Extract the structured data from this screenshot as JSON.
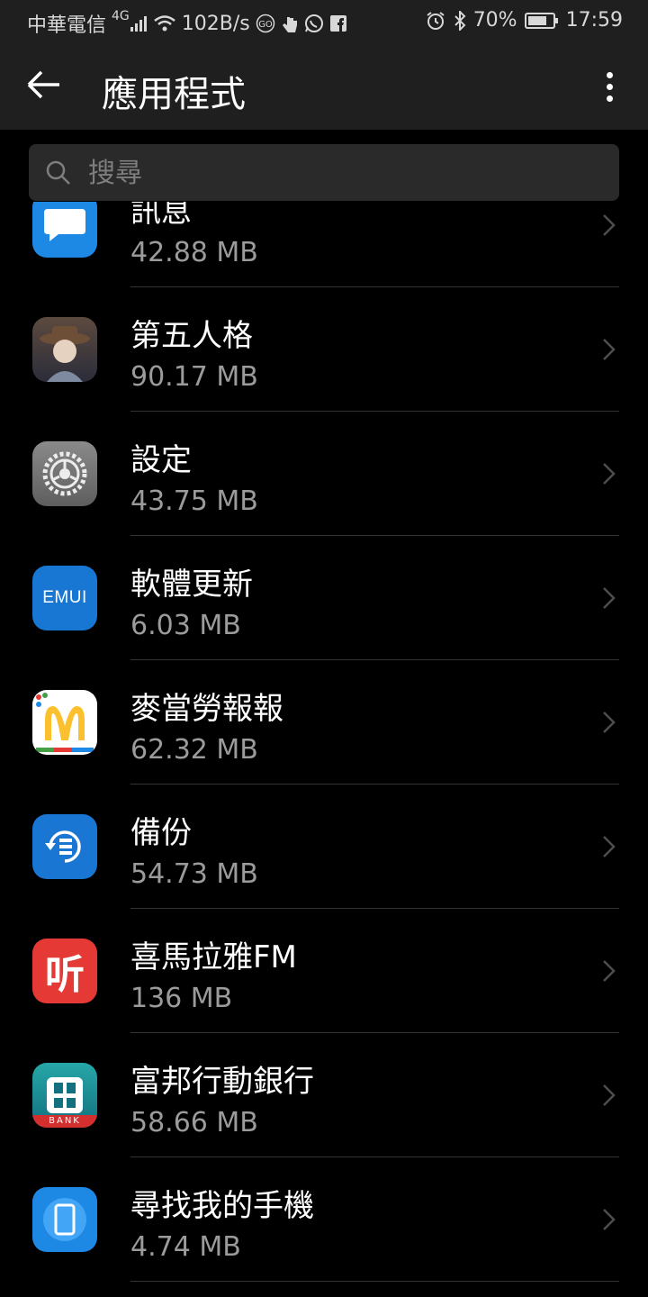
{
  "status_bar": {
    "carrier": "中華電信",
    "network": "4G",
    "speed": "102B/s",
    "battery": "70%",
    "time": "17:59"
  },
  "app_bar": {
    "title": "應用程式"
  },
  "search": {
    "placeholder": "搜尋"
  },
  "apps": [
    {
      "name": "訊息",
      "size": "42.88 MB",
      "icon": "message-icon",
      "color": "#1e88e5"
    },
    {
      "name": "第五人格",
      "size": "90.17 MB",
      "icon": "identity-v-icon",
      "color": "#4a3b35"
    },
    {
      "name": "設定",
      "size": "43.75 MB",
      "icon": "settings-icon",
      "color": "#7a7a7a"
    },
    {
      "name": "軟體更新",
      "size": "6.03 MB",
      "icon": "emui-icon",
      "color": "#1877d2",
      "icon_text": "EMUI"
    },
    {
      "name": "麥當勞報報",
      "size": "62.32 MB",
      "icon": "mcdonalds-icon",
      "color": "#ffffff"
    },
    {
      "name": "備份",
      "size": "54.73 MB",
      "icon": "backup-icon",
      "color": "#1976d2"
    },
    {
      "name": "喜馬拉雅FM",
      "size": "136 MB",
      "icon": "ximalaya-icon",
      "color": "#e53935",
      "icon_text": "听"
    },
    {
      "name": "富邦行動銀行",
      "size": "58.66 MB",
      "icon": "fubon-bank-icon",
      "color": "#1d8f9a",
      "icon_text": "BANK"
    },
    {
      "name": "尋找我的手機",
      "size": "4.74 MB",
      "icon": "find-my-phone-icon",
      "color": "#1e88e5"
    }
  ]
}
